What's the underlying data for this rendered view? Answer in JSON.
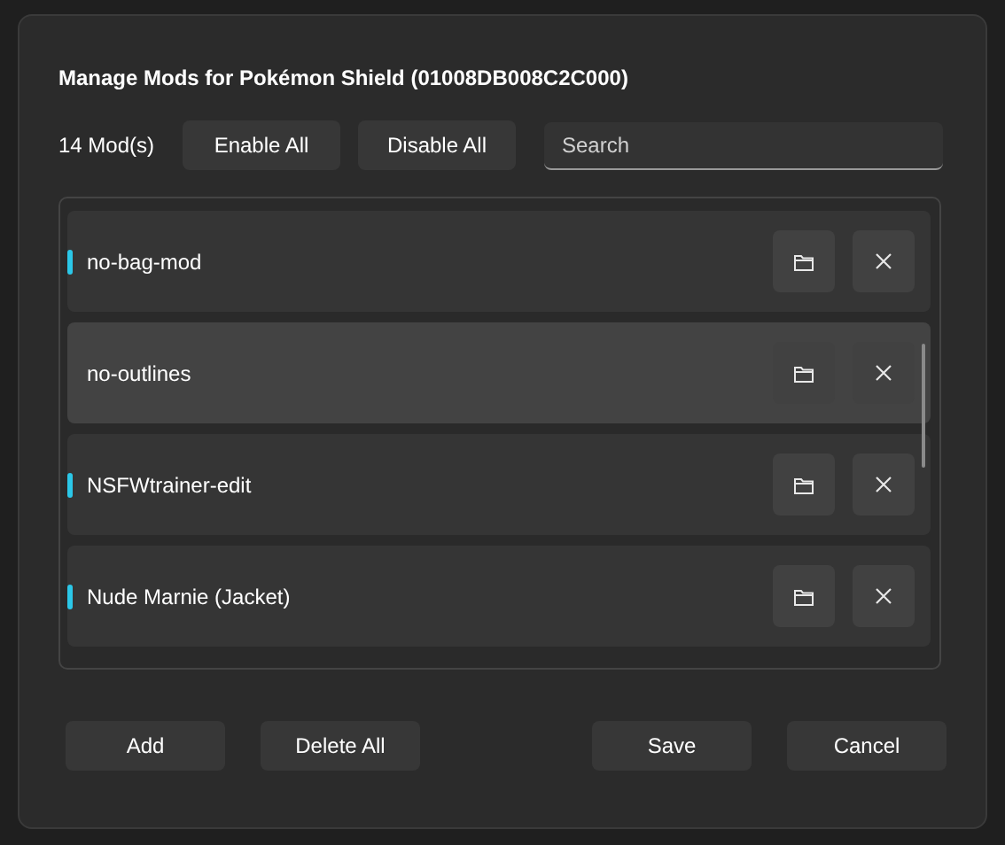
{
  "dialog": {
    "title": "Manage Mods for Pokémon Shield (01008DB008C2C000)"
  },
  "toolbar": {
    "count": "14 Mod(s)",
    "buttons": [
      "Enable All",
      "Disable All"
    ],
    "search": {
      "placeholder": "Search"
    }
  },
  "mods": [
    {
      "name": "no-bag-mod",
      "enabled": true,
      "selected": false
    },
    {
      "name": "no-outlines",
      "enabled": false,
      "selected": true
    },
    {
      "name": "NSFWtrainer-edit",
      "enabled": true,
      "selected": false
    },
    {
      "name": "Nude Marnie (Jacket)",
      "enabled": true,
      "selected": false
    }
  ],
  "footer": {
    "left_buttons": [
      "Add",
      "Delete All"
    ],
    "right_buttons": [
      "Save",
      "Cancel"
    ]
  }
}
